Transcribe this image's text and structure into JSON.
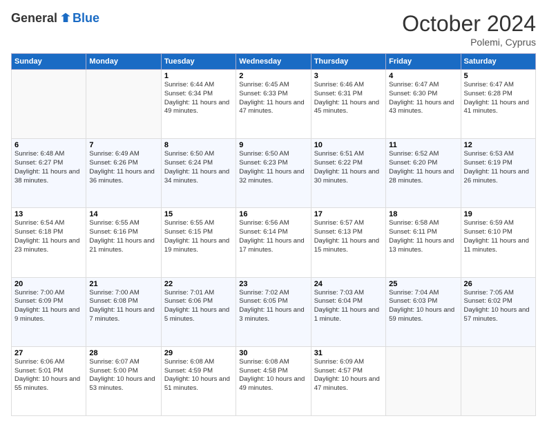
{
  "header": {
    "logo_general": "General",
    "logo_blue": "Blue",
    "month": "October 2024",
    "location": "Polemi, Cyprus"
  },
  "weekdays": [
    "Sunday",
    "Monday",
    "Tuesday",
    "Wednesday",
    "Thursday",
    "Friday",
    "Saturday"
  ],
  "weeks": [
    [
      {
        "day": "",
        "info": ""
      },
      {
        "day": "",
        "info": ""
      },
      {
        "day": "1",
        "info": "Sunrise: 6:44 AM\nSunset: 6:34 PM\nDaylight: 11 hours and 49 minutes."
      },
      {
        "day": "2",
        "info": "Sunrise: 6:45 AM\nSunset: 6:33 PM\nDaylight: 11 hours and 47 minutes."
      },
      {
        "day": "3",
        "info": "Sunrise: 6:46 AM\nSunset: 6:31 PM\nDaylight: 11 hours and 45 minutes."
      },
      {
        "day": "4",
        "info": "Sunrise: 6:47 AM\nSunset: 6:30 PM\nDaylight: 11 hours and 43 minutes."
      },
      {
        "day": "5",
        "info": "Sunrise: 6:47 AM\nSunset: 6:28 PM\nDaylight: 11 hours and 41 minutes."
      }
    ],
    [
      {
        "day": "6",
        "info": "Sunrise: 6:48 AM\nSunset: 6:27 PM\nDaylight: 11 hours and 38 minutes."
      },
      {
        "day": "7",
        "info": "Sunrise: 6:49 AM\nSunset: 6:26 PM\nDaylight: 11 hours and 36 minutes."
      },
      {
        "day": "8",
        "info": "Sunrise: 6:50 AM\nSunset: 6:24 PM\nDaylight: 11 hours and 34 minutes."
      },
      {
        "day": "9",
        "info": "Sunrise: 6:50 AM\nSunset: 6:23 PM\nDaylight: 11 hours and 32 minutes."
      },
      {
        "day": "10",
        "info": "Sunrise: 6:51 AM\nSunset: 6:22 PM\nDaylight: 11 hours and 30 minutes."
      },
      {
        "day": "11",
        "info": "Sunrise: 6:52 AM\nSunset: 6:20 PM\nDaylight: 11 hours and 28 minutes."
      },
      {
        "day": "12",
        "info": "Sunrise: 6:53 AM\nSunset: 6:19 PM\nDaylight: 11 hours and 26 minutes."
      }
    ],
    [
      {
        "day": "13",
        "info": "Sunrise: 6:54 AM\nSunset: 6:18 PM\nDaylight: 11 hours and 23 minutes."
      },
      {
        "day": "14",
        "info": "Sunrise: 6:55 AM\nSunset: 6:16 PM\nDaylight: 11 hours and 21 minutes."
      },
      {
        "day": "15",
        "info": "Sunrise: 6:55 AM\nSunset: 6:15 PM\nDaylight: 11 hours and 19 minutes."
      },
      {
        "day": "16",
        "info": "Sunrise: 6:56 AM\nSunset: 6:14 PM\nDaylight: 11 hours and 17 minutes."
      },
      {
        "day": "17",
        "info": "Sunrise: 6:57 AM\nSunset: 6:13 PM\nDaylight: 11 hours and 15 minutes."
      },
      {
        "day": "18",
        "info": "Sunrise: 6:58 AM\nSunset: 6:11 PM\nDaylight: 11 hours and 13 minutes."
      },
      {
        "day": "19",
        "info": "Sunrise: 6:59 AM\nSunset: 6:10 PM\nDaylight: 11 hours and 11 minutes."
      }
    ],
    [
      {
        "day": "20",
        "info": "Sunrise: 7:00 AM\nSunset: 6:09 PM\nDaylight: 11 hours and 9 minutes."
      },
      {
        "day": "21",
        "info": "Sunrise: 7:00 AM\nSunset: 6:08 PM\nDaylight: 11 hours and 7 minutes."
      },
      {
        "day": "22",
        "info": "Sunrise: 7:01 AM\nSunset: 6:06 PM\nDaylight: 11 hours and 5 minutes."
      },
      {
        "day": "23",
        "info": "Sunrise: 7:02 AM\nSunset: 6:05 PM\nDaylight: 11 hours and 3 minutes."
      },
      {
        "day": "24",
        "info": "Sunrise: 7:03 AM\nSunset: 6:04 PM\nDaylight: 11 hours and 1 minute."
      },
      {
        "day": "25",
        "info": "Sunrise: 7:04 AM\nSunset: 6:03 PM\nDaylight: 10 hours and 59 minutes."
      },
      {
        "day": "26",
        "info": "Sunrise: 7:05 AM\nSunset: 6:02 PM\nDaylight: 10 hours and 57 minutes."
      }
    ],
    [
      {
        "day": "27",
        "info": "Sunrise: 6:06 AM\nSunset: 5:01 PM\nDaylight: 10 hours and 55 minutes."
      },
      {
        "day": "28",
        "info": "Sunrise: 6:07 AM\nSunset: 5:00 PM\nDaylight: 10 hours and 53 minutes."
      },
      {
        "day": "29",
        "info": "Sunrise: 6:08 AM\nSunset: 4:59 PM\nDaylight: 10 hours and 51 minutes."
      },
      {
        "day": "30",
        "info": "Sunrise: 6:08 AM\nSunset: 4:58 PM\nDaylight: 10 hours and 49 minutes."
      },
      {
        "day": "31",
        "info": "Sunrise: 6:09 AM\nSunset: 4:57 PM\nDaylight: 10 hours and 47 minutes."
      },
      {
        "day": "",
        "info": ""
      },
      {
        "day": "",
        "info": ""
      }
    ]
  ]
}
